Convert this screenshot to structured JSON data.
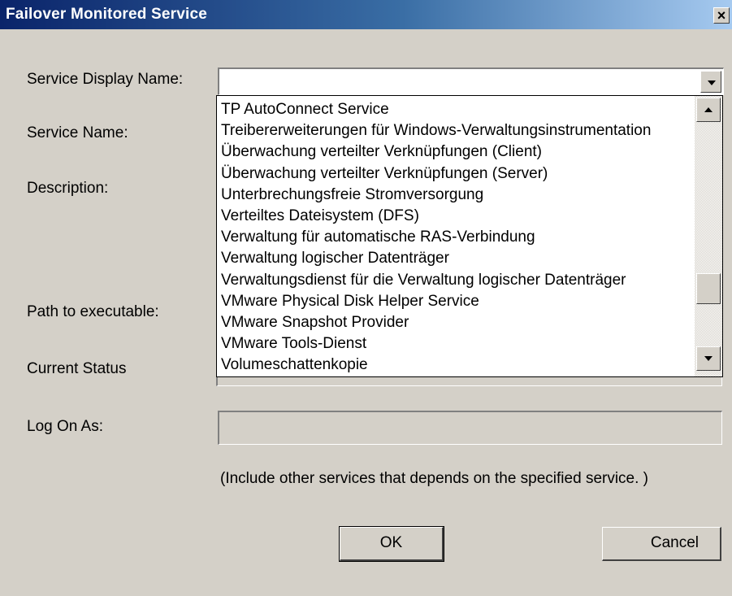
{
  "window": {
    "title": "Failover Monitored Service",
    "close_label": "×"
  },
  "labels": {
    "service_display_name": "Service Display Name:",
    "service_name": "Service Name:",
    "description": "Description:",
    "path_to_executable": "Path to executable:",
    "current_status": "Current Status",
    "log_on_as": "Log On As:"
  },
  "service_display_name": {
    "value": "",
    "options": [
      "TP AutoConnect Service",
      "Treibererweiterungen für Windows-Verwaltungsinstrumentation",
      "Überwachung verteilter Verknüpfungen (Client)",
      "Überwachung verteilter Verknüpfungen (Server)",
      "Unterbrechungsfreie Stromversorgung",
      "Verteiltes Dateisystem (DFS)",
      "Verwaltung für automatische RAS-Verbindung",
      "Verwaltung logischer Datenträger",
      "Verwaltungsdienst für die Verwaltung logischer Datenträger",
      "VMware Physical Disk Helper Service",
      "VMware Snapshot Provider",
      "VMware Tools-Dienst",
      "Volumeschattenkopie"
    ],
    "scroll_position": 0.78
  },
  "log_on_as": {
    "value": ""
  },
  "note": "(Include other services that depends on the specified service. )",
  "buttons": {
    "ok": "OK",
    "cancel": "Cancel"
  }
}
